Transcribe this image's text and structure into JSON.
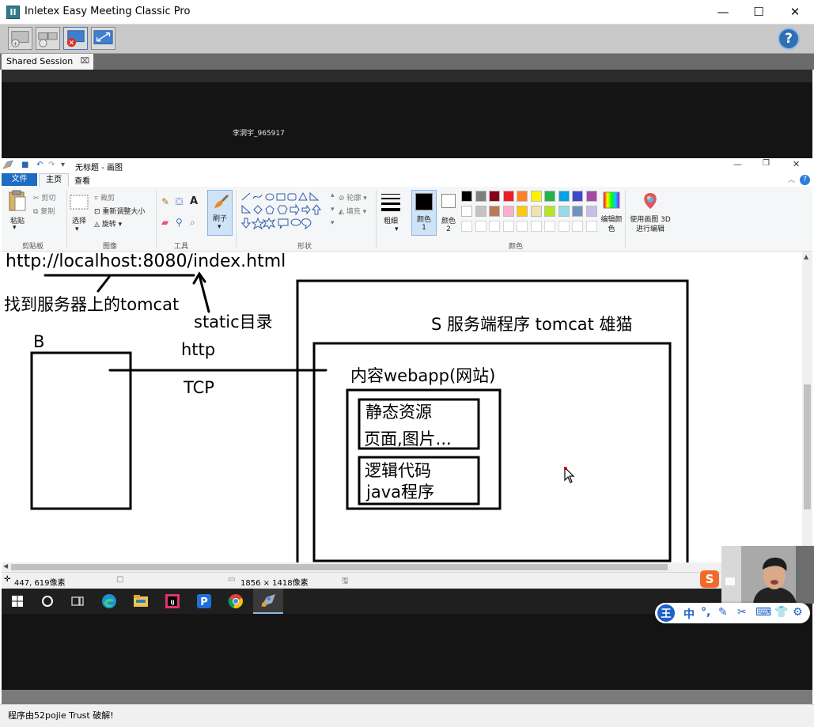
{
  "app": {
    "title": "Inletex Easy Meeting Classic Pro",
    "icon_glyph": "II",
    "help_glyph": "?",
    "window_controls": {
      "minimize": "—",
      "maximize": "☐",
      "close": "✕"
    }
  },
  "toolbar": {
    "buttons": [
      "add-board-icon",
      "add-share-icon",
      "stop-share-icon",
      "fullscreen-icon"
    ]
  },
  "session_tab": {
    "label": "Shared Session",
    "close_glyph": "⌧"
  },
  "presenter": {
    "label": "李洞宇_965917"
  },
  "paint": {
    "window_title": "无标题 - 画图",
    "tabs": {
      "file": "文件",
      "home": "主页",
      "view": "查看"
    },
    "clipboard": {
      "paste": "粘贴",
      "cut": "剪切",
      "copy": "复制",
      "group": "剪贴板"
    },
    "image": {
      "select": "选择",
      "crop": "裁剪",
      "resize": "重新调整大小",
      "rotate": "旋转",
      "group": "图像"
    },
    "tools": {
      "group": "工具",
      "brush": "刷子"
    },
    "shapes": {
      "group": "形状",
      "outline": "轮廓",
      "fill": "填充"
    },
    "size": {
      "label": "粗细"
    },
    "color1": {
      "label": "颜色 1"
    },
    "color2": {
      "label": "颜色 2"
    },
    "colors": {
      "group": "颜色",
      "edit": "编辑颜色",
      "palette_row1": [
        "#000000",
        "#7f7f7f",
        "#880015",
        "#ed1c24",
        "#ff7f27",
        "#fff200",
        "#22b14c",
        "#00a2e8",
        "#3f48cc",
        "#a349a4"
      ],
      "palette_row2": [
        "#ffffff",
        "#c3c3c3",
        "#b97a57",
        "#ffaec9",
        "#ffc90e",
        "#efe4b0",
        "#b5e61d",
        "#99d9ea",
        "#7092be",
        "#c8bfe7"
      ]
    },
    "paint3d": "使用画图 3D 进行编辑",
    "status": {
      "cursor": "447, 619像素",
      "size": "1856 × 1418像素"
    }
  },
  "canvas": {
    "url": "http://localhost:8080/index.html",
    "find_tomcat": "找到服务器上的tomcat",
    "static_dir": "static目录",
    "server_label": "S  服务端程序 tomcat 雄猫",
    "client_label": "B",
    "http": "http",
    "tcp": "TCP",
    "webapp": "内容webapp(网站)",
    "static_res_1": "静态资源",
    "static_res_2": "页面,图片...",
    "logic_1": "逻辑代码",
    "logic_2": "java程序"
  },
  "ime": {
    "mode": "中"
  },
  "bottom_status": "程序由52pojie Trust 破解!"
}
